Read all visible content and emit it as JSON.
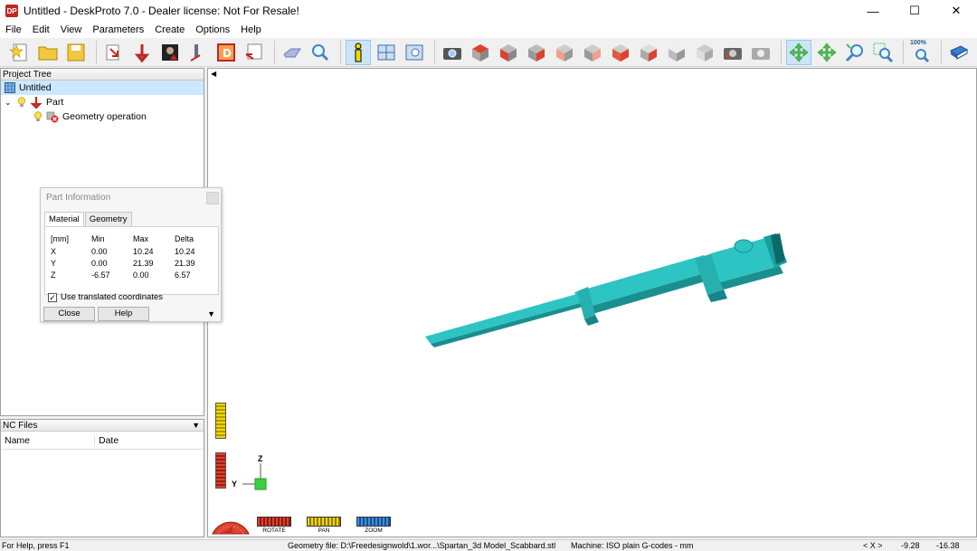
{
  "window": {
    "icon_label": "DP",
    "title": "Untitled - DeskProto 7.0 - Dealer license: Not For Resale!",
    "controls": [
      "—",
      "☐",
      "✕"
    ]
  },
  "menu": [
    "File",
    "Edit",
    "View",
    "Parameters",
    "Create",
    "Options",
    "Help"
  ],
  "toolbar": {
    "zoom_badge": "100%"
  },
  "project_tree": {
    "header": "Project Tree",
    "items": [
      {
        "label": "Untitled",
        "level": 0
      },
      {
        "label": "Part",
        "level": 1
      },
      {
        "label": "Geometry operation",
        "level": 2
      }
    ]
  },
  "nc_files": {
    "header": "NC Files",
    "columns": [
      "Name",
      "Date"
    ]
  },
  "part_info": {
    "title": "Part Information",
    "tabs": [
      "Material",
      "Geometry"
    ],
    "headers": [
      "[mm]",
      "Min",
      "Max",
      "Delta"
    ],
    "rows": [
      [
        "X",
        "0.00",
        "10.24",
        "10.24"
      ],
      [
        "Y",
        "0.00",
        "21.39",
        "21.39"
      ],
      [
        "Z",
        "-6.57",
        "0.00",
        "6.57"
      ]
    ],
    "checkbox_label": "Use translated coordinates",
    "checkbox_checked": true,
    "close_label": "Close",
    "help_label": "Help"
  },
  "axes": {
    "z_label": "Z",
    "y_label": "Y"
  },
  "bottom_controls": {
    "rotate": "ROTATE",
    "pan": "PAN",
    "zoom": "ZOOM"
  },
  "status": {
    "help": "For Help, press F1",
    "geometry": "Geometry file: D:\\Freedesignwold\\1.wor...\\Spartan_3d Model_Scabbard.stl",
    "machine": "Machine: ISO plain G-codes - mm",
    "axis": "< X >",
    "x_value": "-9.28",
    "y_value": "-16.38"
  },
  "colors": {
    "model": "#2ec4c4",
    "model_dark": "#1a8f8f",
    "selection": "#cce8ff",
    "accent_active": "#cce4f7"
  }
}
